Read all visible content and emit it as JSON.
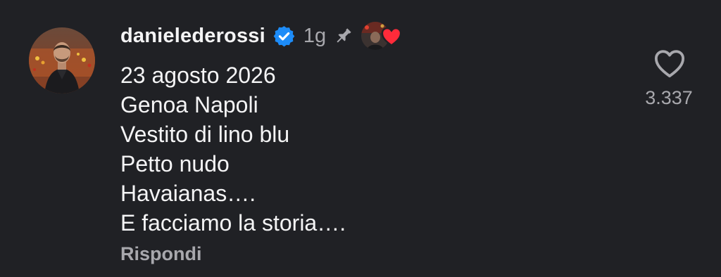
{
  "comment": {
    "username": "danielederossi",
    "verified": true,
    "time": "1g",
    "pinned": true,
    "liked_by_author": true,
    "lines": [
      "23 agosto 2026",
      "Genoa Napoli",
      "Vestito di lino blu",
      "Petto nudo",
      "Havaianas….",
      "E facciamo la storia…."
    ],
    "reply_label": "Rispondi",
    "like_count": "3.337"
  },
  "icons": {
    "verified": "verified-badge-icon",
    "pin": "pin-icon",
    "like": "heart-outline-icon",
    "author_like": "red-heart-icon"
  },
  "colors": {
    "background": "#202125",
    "text": "#f4f4f5",
    "muted": "#a8a8ad",
    "verified_blue": "#1d8cf8",
    "heart_red": "#ff2b3a"
  }
}
